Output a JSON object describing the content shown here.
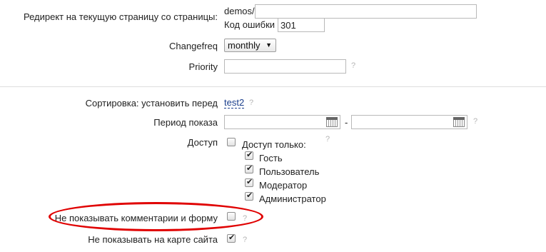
{
  "redirect": {
    "label": "Редирект на текущую страницу со страницы:",
    "prefix": "demos/",
    "value": "",
    "error_code_label": "Код ошибки",
    "error_code_value": "301"
  },
  "changefreq": {
    "label": "Changefreq",
    "selected": "monthly"
  },
  "priority": {
    "label": "Priority",
    "value": "",
    "help": "?"
  },
  "sorting": {
    "label": "Сортировка: установить перед",
    "link": "test2",
    "help": "?"
  },
  "period": {
    "label": "Период показа",
    "from": "",
    "to": "",
    "separator": "-",
    "help": "?"
  },
  "access": {
    "label": "Доступ",
    "only_label": "Доступ только:",
    "only_checked": false,
    "help": "?",
    "roles": [
      {
        "label": "Гость",
        "checked": true
      },
      {
        "label": "Пользователь",
        "checked": true
      },
      {
        "label": "Модератор",
        "checked": true
      },
      {
        "label": "Администратор",
        "checked": true
      }
    ]
  },
  "hide_comments": {
    "label": "Не показывать комментарии и форму",
    "checked": false,
    "help": "?"
  },
  "hide_sitemap": {
    "label": "Не показывать на карте сайта",
    "checked": true,
    "help": "?"
  },
  "colors": {
    "highlight_ellipse": "#e00000",
    "link": "#1a3e8c",
    "help": "#b5b5b5"
  }
}
